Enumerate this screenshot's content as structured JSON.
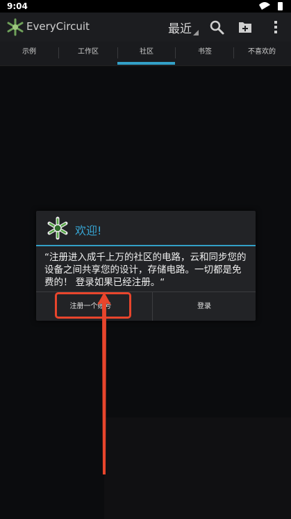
{
  "status": {
    "time": "9:04"
  },
  "actionbar": {
    "app_title": "EveryCircuit",
    "sort_label": "最近"
  },
  "tabs": [
    {
      "label": "示例"
    },
    {
      "label": "工作区"
    },
    {
      "label": "社区"
    },
    {
      "label": "书签"
    },
    {
      "label": "不喜欢的"
    }
  ],
  "dialog": {
    "title": "欢迎!",
    "message": "“注册进入成千上万的社区的电路，云和同步您的设备之间共享您的设计，存储电路。一切都是免费的！ 登录如果已经注册。“",
    "register_label": "注册一个账号",
    "login_label": "登录"
  },
  "colors": {
    "accent": "#33a0c7",
    "annotation": "#e8452c"
  }
}
